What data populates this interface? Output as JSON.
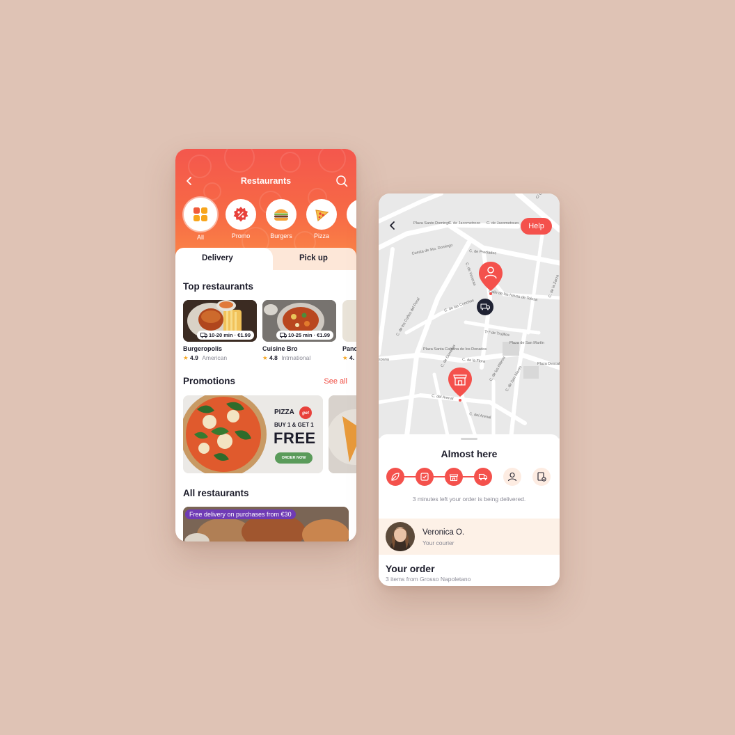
{
  "colors": {
    "background": "#dfc3b5",
    "accent": "#f4514c",
    "promo_badge": "#6f3bb5",
    "order_button": "#5a9b5a"
  },
  "restaurants_screen": {
    "title": "Restaurants",
    "categories": [
      {
        "label": "All",
        "icon": "grid-icon"
      },
      {
        "label": "Promo",
        "icon": "percent-icon"
      },
      {
        "label": "Burgers",
        "icon": "burger-icon"
      },
      {
        "label": "Pizza",
        "icon": "pizza-icon"
      }
    ],
    "tabs": [
      {
        "label": "Delivery",
        "selected": true
      },
      {
        "label": "Pick up",
        "selected": false
      }
    ],
    "top_restaurants": {
      "title": "Top restaurants",
      "items": [
        {
          "name": "Burgeropolis",
          "badge": "10-20 min · €1.99",
          "rating": "4.9",
          "cuisine": "American"
        },
        {
          "name": "Cuisine Bro",
          "badge": "10-25 min · €1.99",
          "rating": "4.8",
          "cuisine": "Intrnational"
        },
        {
          "name": "Panc",
          "badge": "",
          "rating": "4.",
          "cuisine": ""
        }
      ]
    },
    "promotions": {
      "title": "Promotions",
      "see_all": "See all",
      "banner": {
        "brand": "PIZZA",
        "brand_badge": "get",
        "offer": "BUY 1 & GET 1",
        "headline": "FREE",
        "cta": "ORDER NOW"
      }
    },
    "all_restaurants": {
      "title": "All restaurants",
      "badge": "Free delivery on purchases from €30"
    }
  },
  "tracking_screen": {
    "help_label": "Help",
    "map_labels": [
      "C/ Gran Vía",
      "Plaza Santo Domingo",
      "C. de Jacometrezo",
      "C. de Jacometrezo",
      "Cuesta de Sto. Domingo",
      "C. de Preciados",
      "C. de Veneras",
      "Calle de las Navas de Tolosa",
      "C. de los Caños del Peral",
      "C. de las Conchas",
      "C. de la Flora",
      "Tr.ª de Trujillos",
      "Plaza de San Martín",
      "Plaza Santa Catalina de los Donados",
      "C. de Donados",
      "C. del Arenal",
      "C. del Arenal",
      "Plaza Descalzas",
      "C. de San Martín",
      "C. de las Hileras",
      "C. de la Zarza",
      "spana"
    ],
    "status_title": "Almost here",
    "steps": [
      {
        "icon": "leaf-icon",
        "done": true
      },
      {
        "icon": "checklist-icon",
        "done": true
      },
      {
        "icon": "store-icon",
        "done": true
      },
      {
        "icon": "delivery-truck-icon",
        "done": true
      },
      {
        "icon": "person-icon",
        "done": false
      },
      {
        "icon": "receipt-icon",
        "done": false
      }
    ],
    "eta_text": "3 minutes left your order is being delivered.",
    "courier": {
      "name": "Veronica O.",
      "role": "Your courier"
    },
    "order": {
      "title": "Your order",
      "subtitle": "3 items from Grosso Napoletano"
    }
  }
}
